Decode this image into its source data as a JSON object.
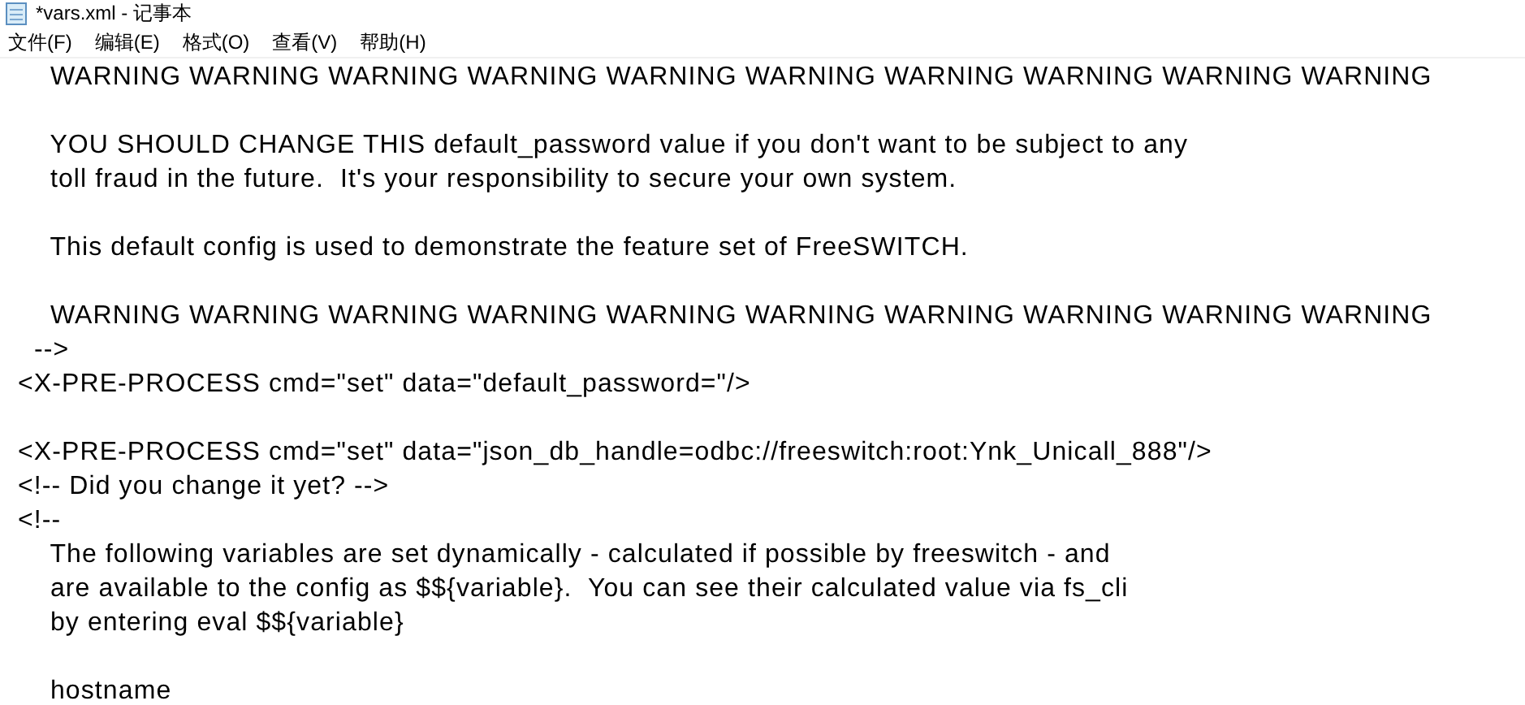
{
  "window": {
    "title": "*vars.xml - 记事本"
  },
  "menu": [
    "文件(F)",
    "编辑(E)",
    "格式(O)",
    "查看(V)",
    "帮助(H)"
  ],
  "document": {
    "paragraphs": [
      [
        "    WARNING WARNING WARNING WARNING WARNING WARNING WARNING WARNING WARNING WARNING"
      ],
      [
        "    YOU SHOULD CHANGE THIS default_password value if you don't want to be subject to any",
        "    toll fraud in the future.  It's your responsibility to secure your own system."
      ],
      [
        "    This default config is used to demonstrate the feature set of FreeSWITCH."
      ],
      [
        "    WARNING WARNING WARNING WARNING WARNING WARNING WARNING WARNING WARNING WARNING",
        "  -->",
        "<X-PRE-PROCESS cmd=\"set\" data=\"default_password=\"/>"
      ],
      [
        "<X-PRE-PROCESS cmd=\"set\" data=\"json_db_handle=odbc://freeswitch:root:Ynk_Unicall_888\"/>",
        "<!-- Did you change it yet? -->",
        "<!--",
        "    The following variables are set dynamically - calculated if possible by freeswitch - and",
        "    are available to the config as $${variable}.  You can see their calculated value via fs_cli",
        "    by entering eval $${variable}"
      ],
      [
        "    hostname"
      ]
    ]
  }
}
